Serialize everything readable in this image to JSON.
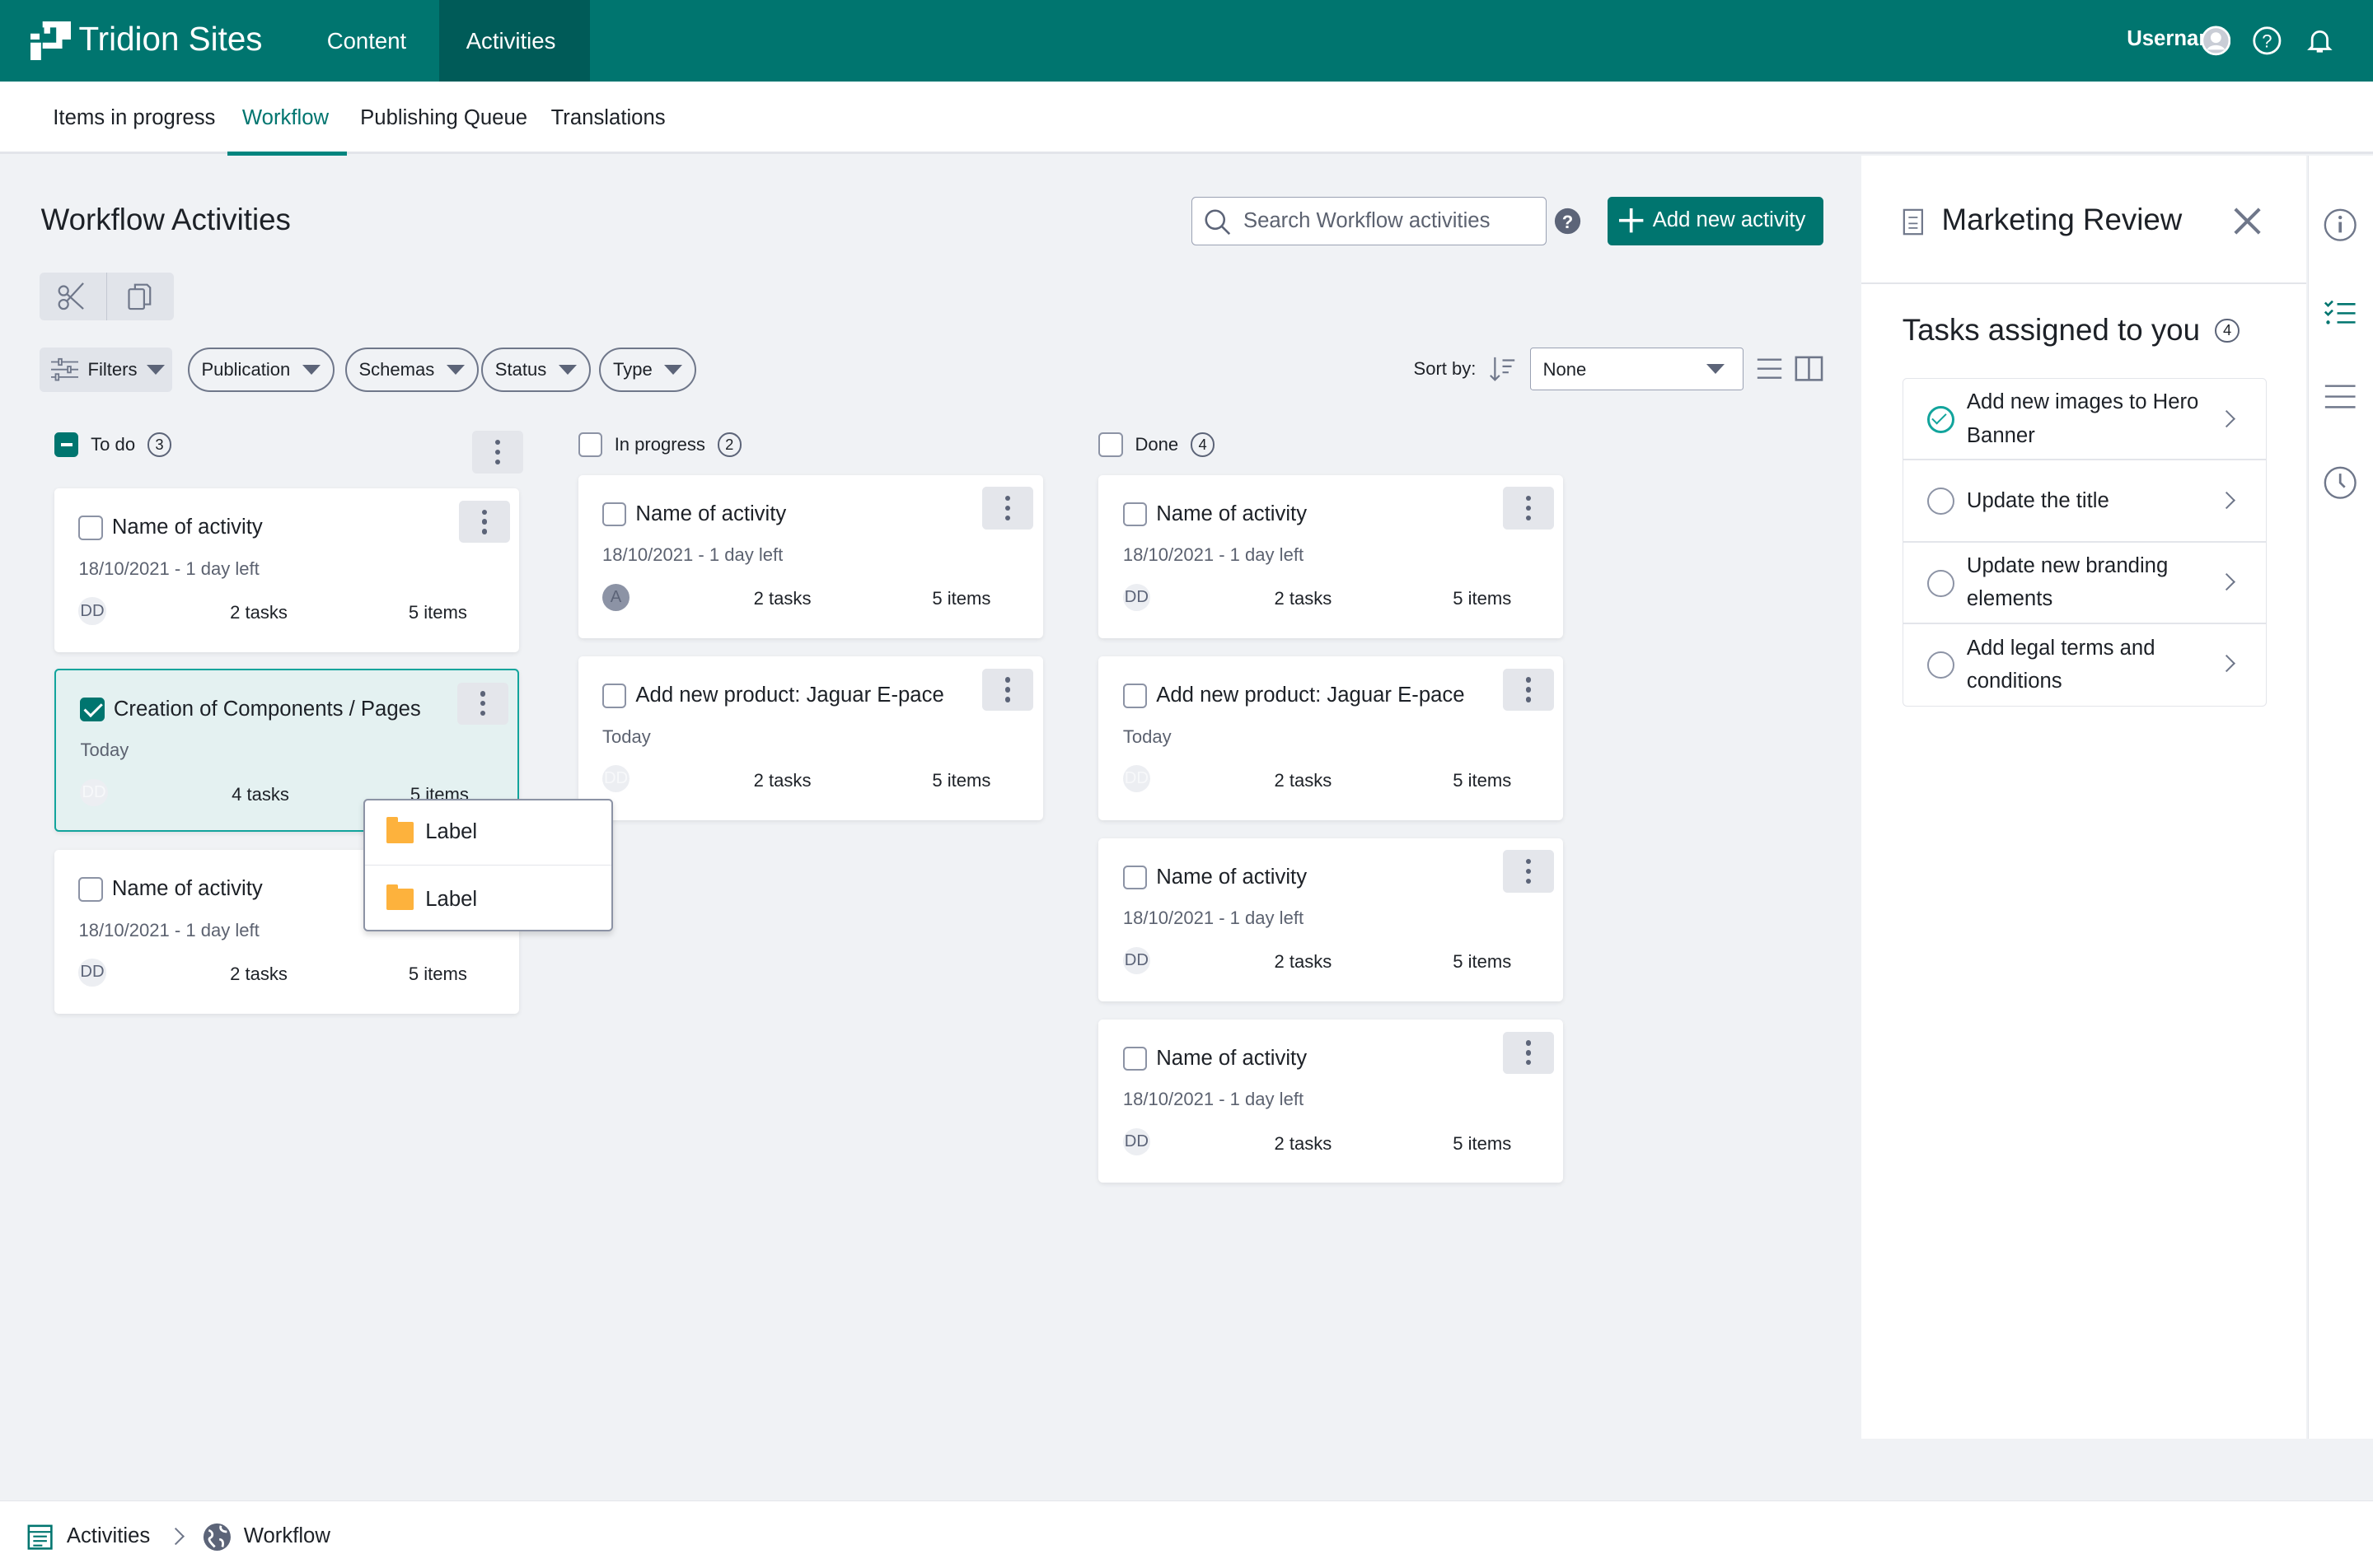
{
  "app": {
    "brand": "Tridion Sites",
    "nav": [
      "Content",
      "Activities"
    ],
    "active_nav": "Activities",
    "username": "Username"
  },
  "subnav": {
    "items": [
      "Items in progress",
      "Workflow",
      "Publishing Queue",
      "Translations"
    ],
    "active": "Workflow"
  },
  "page": {
    "title": "Workflow Activities",
    "search_placeholder": "Search Workflow activities",
    "add_button": "Add new activity"
  },
  "filters": {
    "filters_label": "Filters",
    "dropdowns": [
      "Publication",
      "Schemas",
      "Status",
      "Type"
    ],
    "sort_label": "Sort by:",
    "sort_value": "None"
  },
  "columns": [
    {
      "title": "To do",
      "count": "3",
      "state": "indeterminate",
      "cards": [
        {
          "title": "Name of activity",
          "date": "18/10/2021 - 1 day left",
          "avatar": "DD",
          "tasks": "2 tasks",
          "items": "5 items",
          "checked": false,
          "selected": false
        },
        {
          "title": "Creation of Components / Pages",
          "date": "Today",
          "avatar": "DD",
          "tasks": "4 tasks",
          "items": "5 items",
          "checked": true,
          "selected": true
        },
        {
          "title": "Name of activity",
          "date": "18/10/2021 - 1 day left",
          "avatar": "DD",
          "tasks": "2 tasks",
          "items": "5 items",
          "checked": false,
          "selected": false
        }
      ]
    },
    {
      "title": "In progress",
      "count": "2",
      "state": "unchecked",
      "cards": [
        {
          "title": "Name of activity",
          "date": "18/10/2021 - 1 day left",
          "avatar": "A",
          "tasks": "2 tasks",
          "items": "5 items",
          "checked": false,
          "selected": false
        },
        {
          "title": "Add new product: Jaguar E-pace",
          "date": "Today",
          "avatar": "DD",
          "tasks": "2 tasks",
          "items": "5 items",
          "checked": false,
          "selected": false
        }
      ]
    },
    {
      "title": "Done",
      "count": "4",
      "state": "unchecked",
      "cards": [
        {
          "title": "Name of activity",
          "date": "18/10/2021 - 1 day left",
          "avatar": "DD",
          "tasks": "2 tasks",
          "items": "5 items",
          "checked": false,
          "selected": false
        },
        {
          "title": "Add new product: Jaguar E-pace",
          "date": "Today",
          "avatar": "DD",
          "tasks": "2 tasks",
          "items": "5 items",
          "checked": false,
          "selected": false
        },
        {
          "title": "Name of activity",
          "date": "18/10/2021 - 1 day left",
          "avatar": "DD",
          "tasks": "2 tasks",
          "items": "5 items",
          "checked": false,
          "selected": false
        },
        {
          "title": "Name of activity",
          "date": "18/10/2021 - 1 day left",
          "avatar": "DD",
          "tasks": "2 tasks",
          "items": "5 items",
          "checked": false,
          "selected": false
        }
      ]
    }
  ],
  "context_menu": {
    "items": [
      "Label",
      "Label"
    ]
  },
  "panel": {
    "title": "Marketing Review",
    "tasks_heading": "Tasks assigned to you",
    "tasks_count": "4",
    "tasks": [
      {
        "label": "Add new images to Hero Banner",
        "done": true
      },
      {
        "label": "Update the title",
        "done": false
      },
      {
        "label": "Update new branding elements",
        "done": false
      },
      {
        "label": "Add legal terms and conditions",
        "done": false
      }
    ]
  },
  "footer": {
    "breadcrumb": [
      "Activities",
      "Workflow"
    ]
  },
  "colors": {
    "brand": "#00756f",
    "brand_dark": "#005b58",
    "accent": "#12a49c",
    "folder": "#fdb23d"
  }
}
